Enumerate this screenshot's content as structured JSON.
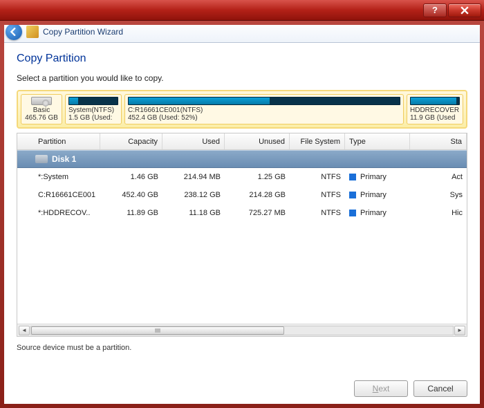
{
  "window": {
    "title": "Copy Partition Wizard"
  },
  "page": {
    "heading": "Copy Partition",
    "instruction": "Select a partition you would like to copy.",
    "hint": "Source device must be a partition."
  },
  "disk_map": {
    "basic_label": "Basic",
    "basic_size": "465.76 GB",
    "system": {
      "label": "System(NTFS)",
      "sub": "1.5 GB (Used:"
    },
    "c": {
      "label": "C:R16661CE001(NTFS)",
      "sub": "452.4 GB (Used: 52%)"
    },
    "recovery": {
      "label": "HDDRECOVER",
      "sub": "11.9 GB (Used"
    }
  },
  "columns": {
    "partition": "Partition",
    "capacity": "Capacity",
    "used": "Used",
    "unused": "Unused",
    "fs": "File System",
    "type": "Type",
    "status": "Sta"
  },
  "group": {
    "label": "Disk 1"
  },
  "rows": [
    {
      "partition": "*:System",
      "capacity": "1.46 GB",
      "used": "214.94 MB",
      "unused": "1.25 GB",
      "fs": "NTFS",
      "type": "Primary",
      "status": "Act"
    },
    {
      "partition": "C:R16661CE001",
      "capacity": "452.40 GB",
      "used": "238.12 GB",
      "unused": "214.28 GB",
      "fs": "NTFS",
      "type": "Primary",
      "status": "Sys"
    },
    {
      "partition": "*:HDDRECOV..",
      "capacity": "11.89 GB",
      "used": "11.18 GB",
      "unused": "725.27 MB",
      "fs": "NTFS",
      "type": "Primary",
      "status": "Hic"
    }
  ],
  "buttons": {
    "next": "Next",
    "cancel": "Cancel"
  }
}
